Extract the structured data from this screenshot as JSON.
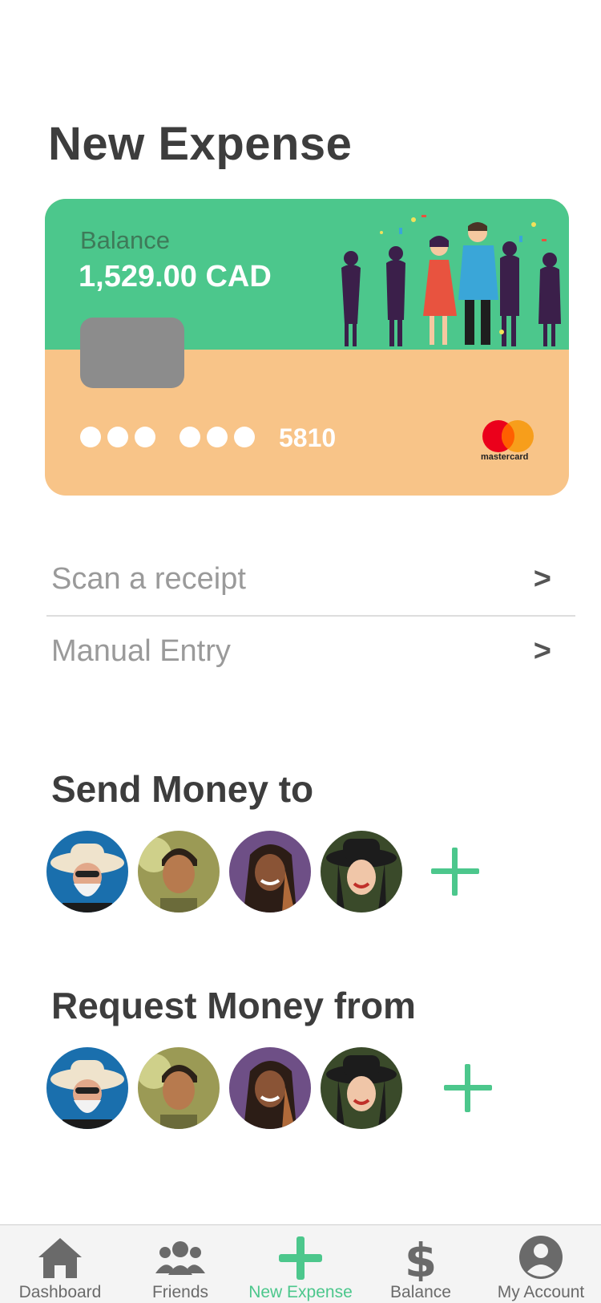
{
  "page": {
    "title": "New Expense"
  },
  "card": {
    "balance_label": "Balance",
    "balance_value": "1,529.00 CAD",
    "last_four": "5810",
    "network": "mastercard",
    "colors": {
      "top": "#4cc78c",
      "bottom": "#f8c488",
      "chip": "#8c8c8c"
    }
  },
  "options": [
    {
      "label": "Scan a receipt",
      "chevron": ">"
    },
    {
      "label": "Manual Entry",
      "chevron": ">"
    }
  ],
  "send": {
    "title": "Send Money to",
    "contacts": [
      "man-cowboy-hat",
      "young-man",
      "smiling-woman",
      "woman-black-hat"
    ]
  },
  "request": {
    "title": "Request Money from",
    "contacts": [
      "man-cowboy-hat",
      "young-man",
      "smiling-woman",
      "woman-black-hat"
    ]
  },
  "tabs": [
    {
      "label": "Dashboard",
      "icon": "home-icon"
    },
    {
      "label": "Friends",
      "icon": "friends-icon"
    },
    {
      "label": "New Expense",
      "icon": "plus-icon",
      "active": true
    },
    {
      "label": "Balance",
      "icon": "dollar-icon"
    },
    {
      "label": "My Account",
      "icon": "account-icon"
    }
  ],
  "accent": "#4cc78c"
}
